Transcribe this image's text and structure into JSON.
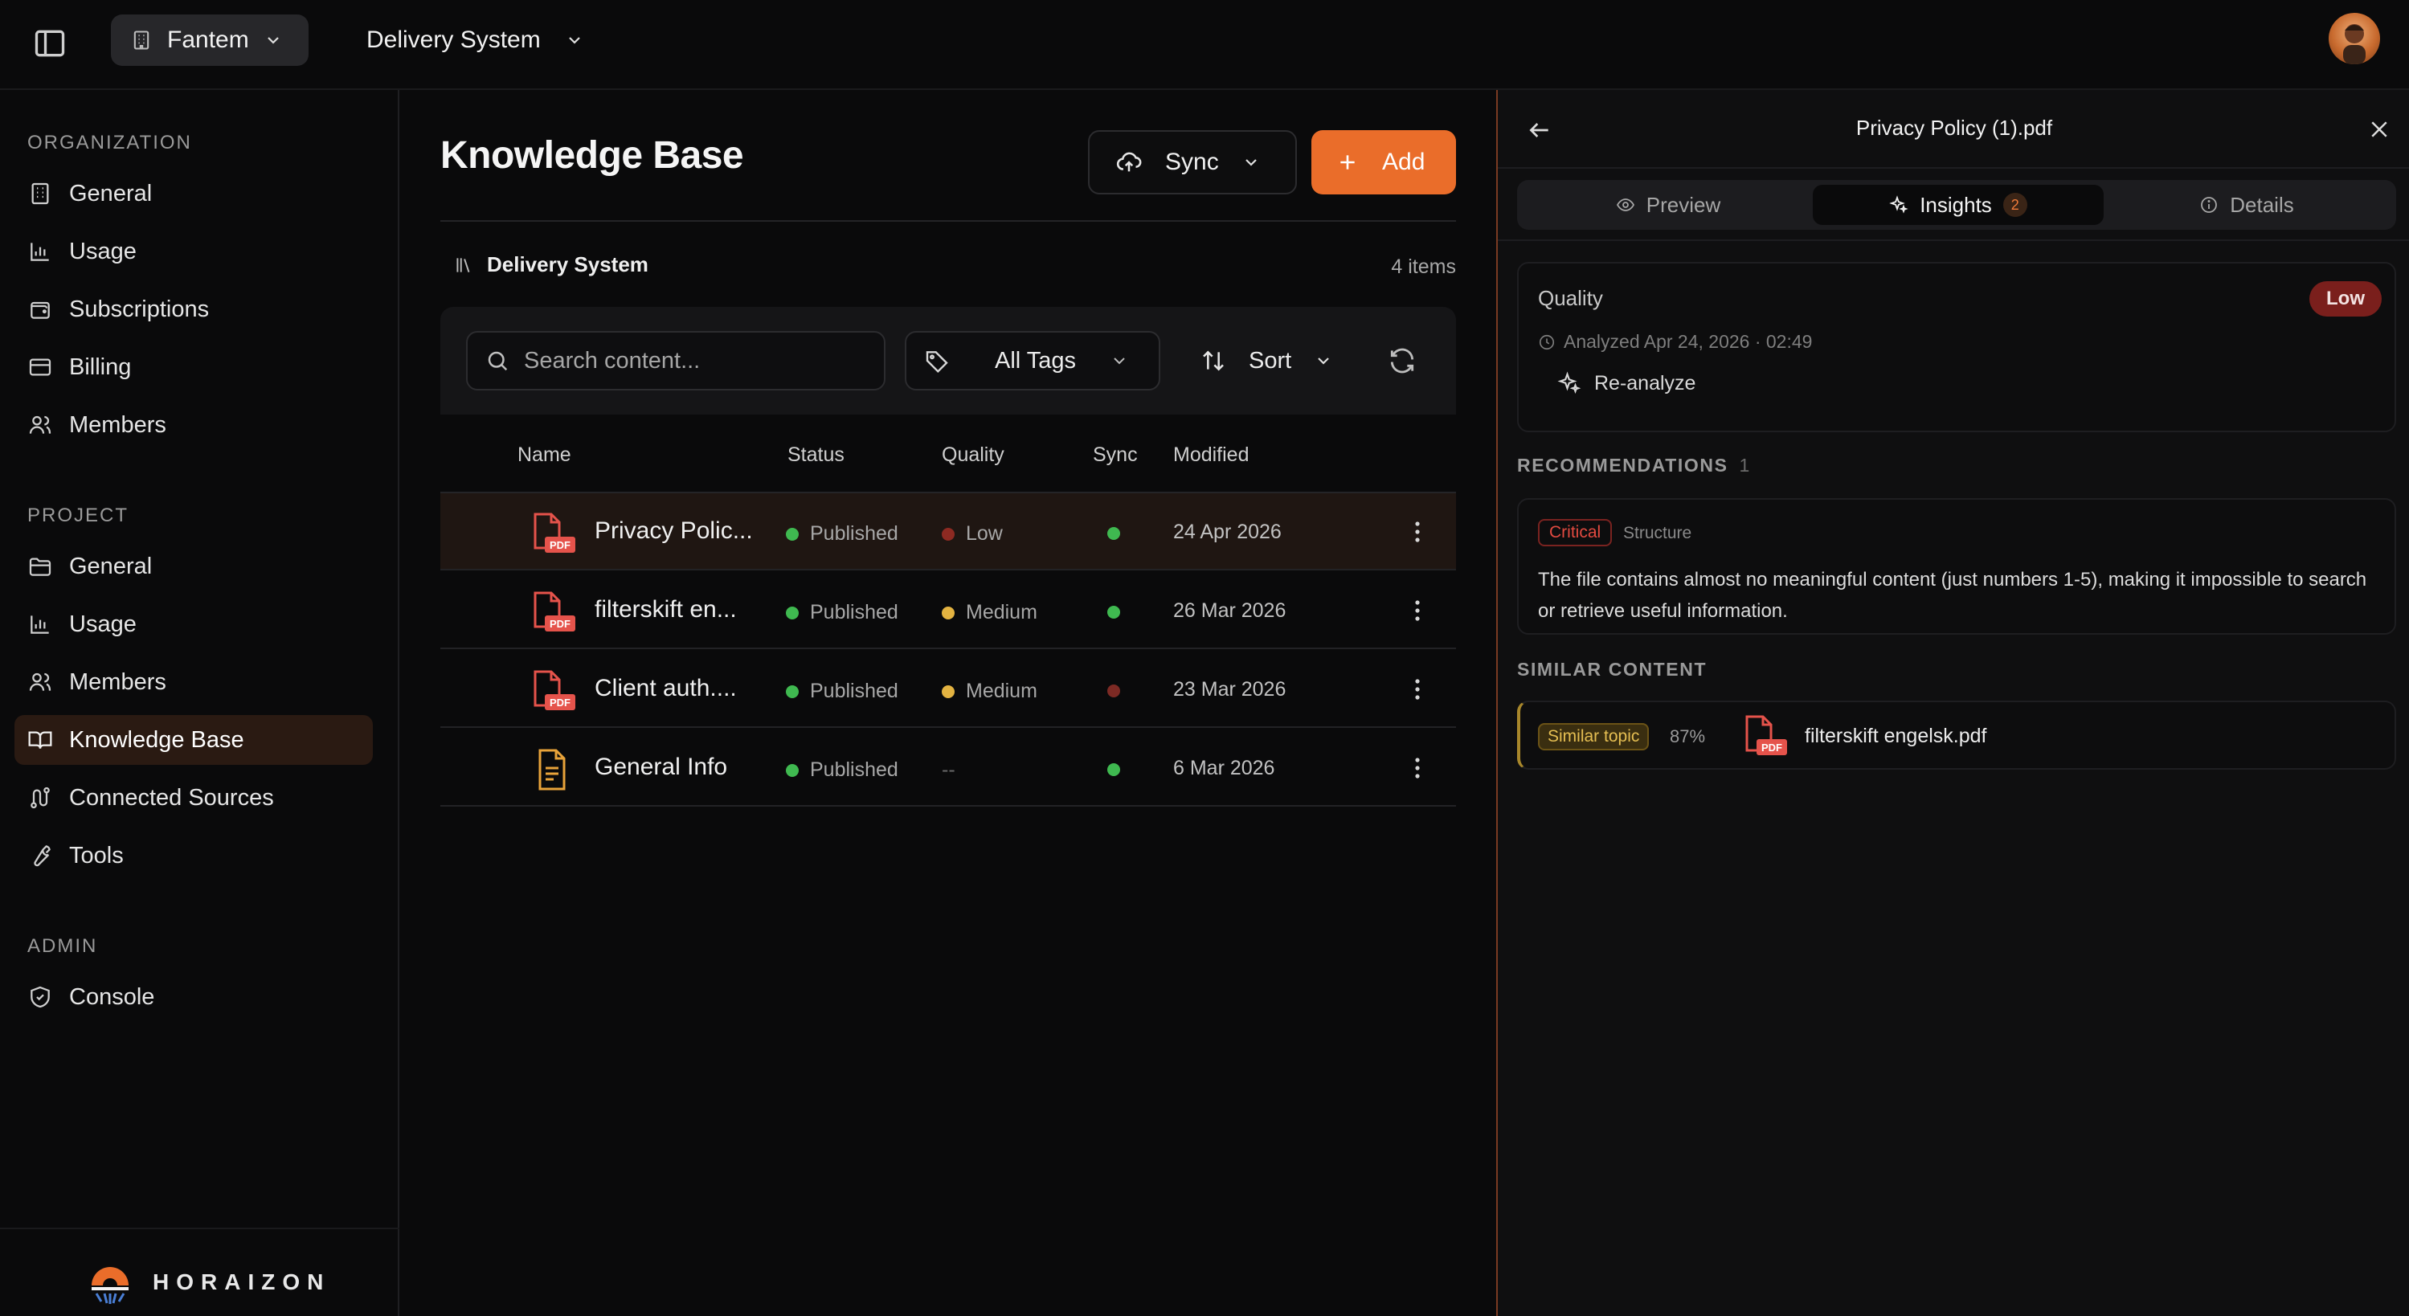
{
  "topbar": {
    "org_name": "Fantem",
    "project_name": "Delivery System"
  },
  "sidebar": {
    "sections": {
      "organization": "ORGANIZATION",
      "project": "PROJECT",
      "admin": "ADMIN"
    },
    "org_items": [
      {
        "label": "General",
        "icon": "building-icon"
      },
      {
        "label": "Usage",
        "icon": "bar-chart-icon"
      },
      {
        "label": "Subscriptions",
        "icon": "wallet-icon"
      },
      {
        "label": "Billing",
        "icon": "credit-card-icon"
      },
      {
        "label": "Members",
        "icon": "users-icon"
      }
    ],
    "project_items": [
      {
        "label": "General",
        "icon": "folder-icon"
      },
      {
        "label": "Usage",
        "icon": "bar-chart-icon"
      },
      {
        "label": "Members",
        "icon": "users-icon"
      },
      {
        "label": "Knowledge Base",
        "icon": "book-icon",
        "active": true
      },
      {
        "label": "Connected Sources",
        "icon": "route-icon"
      },
      {
        "label": "Tools",
        "icon": "wrench-icon"
      }
    ],
    "admin_items": [
      {
        "label": "Console",
        "icon": "shield-check-icon"
      }
    ],
    "brand": "HORAIZON"
  },
  "main": {
    "title": "Knowledge Base",
    "sync_label": "Sync",
    "add_label": "Add",
    "breadcrumb": "Delivery System",
    "item_count": "4 items",
    "search_placeholder": "Search content...",
    "tags_label": "All Tags",
    "sort_label": "Sort",
    "columns": [
      "Name",
      "Status",
      "Quality",
      "Sync",
      "Modified"
    ],
    "rows": [
      {
        "name": "Privacy Polic...",
        "type": "pdf",
        "status": "Published",
        "quality": "Low",
        "quality_color": "#8e2a22",
        "sync_color": "#3fb950",
        "modified": "24 Apr 2026",
        "selected": true
      },
      {
        "name": "filterskift en...",
        "type": "pdf",
        "status": "Published",
        "quality": "Medium",
        "quality_color": "#e3b341",
        "sync_color": "#3fb950",
        "modified": "26 Mar 2026",
        "selected": false
      },
      {
        "name": "Client auth....",
        "type": "pdf",
        "status": "Published",
        "quality": "Medium",
        "quality_color": "#e3b341",
        "sync_color": "#7d2a24",
        "modified": "23 Mar 2026",
        "selected": false
      },
      {
        "name": "General Info",
        "type": "doc",
        "status": "Published",
        "quality": "--",
        "quality_color": "",
        "sync_color": "#3fb950",
        "modified": "6 Mar 2026",
        "selected": false
      }
    ]
  },
  "panel": {
    "title": "Privacy Policy (1).pdf",
    "tabs": [
      {
        "label": "Preview",
        "icon": "eye-icon"
      },
      {
        "label": "Insights",
        "icon": "sparkles-icon",
        "count": "2",
        "active": true
      },
      {
        "label": "Details",
        "icon": "info-icon"
      }
    ],
    "quality": {
      "label": "Quality",
      "level": "Low",
      "analyzed": "Analyzed Apr 24, 2026 · 02:49",
      "reanalyze_label": "Re-analyze"
    },
    "recommendations": {
      "heading": "RECOMMENDATIONS",
      "count": "1",
      "items": [
        {
          "severity": "Critical",
          "category": "Structure",
          "text": "The file contains almost no meaningful content (just numbers 1-5), making it impossible to search or retrieve useful information."
        }
      ]
    },
    "similar": {
      "heading": "SIMILAR CONTENT",
      "items": [
        {
          "badge": "Similar topic",
          "percent": "87%",
          "file": "filterskift engelsk.pdf"
        }
      ]
    }
  },
  "colors": {
    "accent": "#ea6d2a",
    "published": "#3fb950",
    "low": "#8e2a22",
    "medium": "#e3b341",
    "critical": "#e24a40"
  }
}
